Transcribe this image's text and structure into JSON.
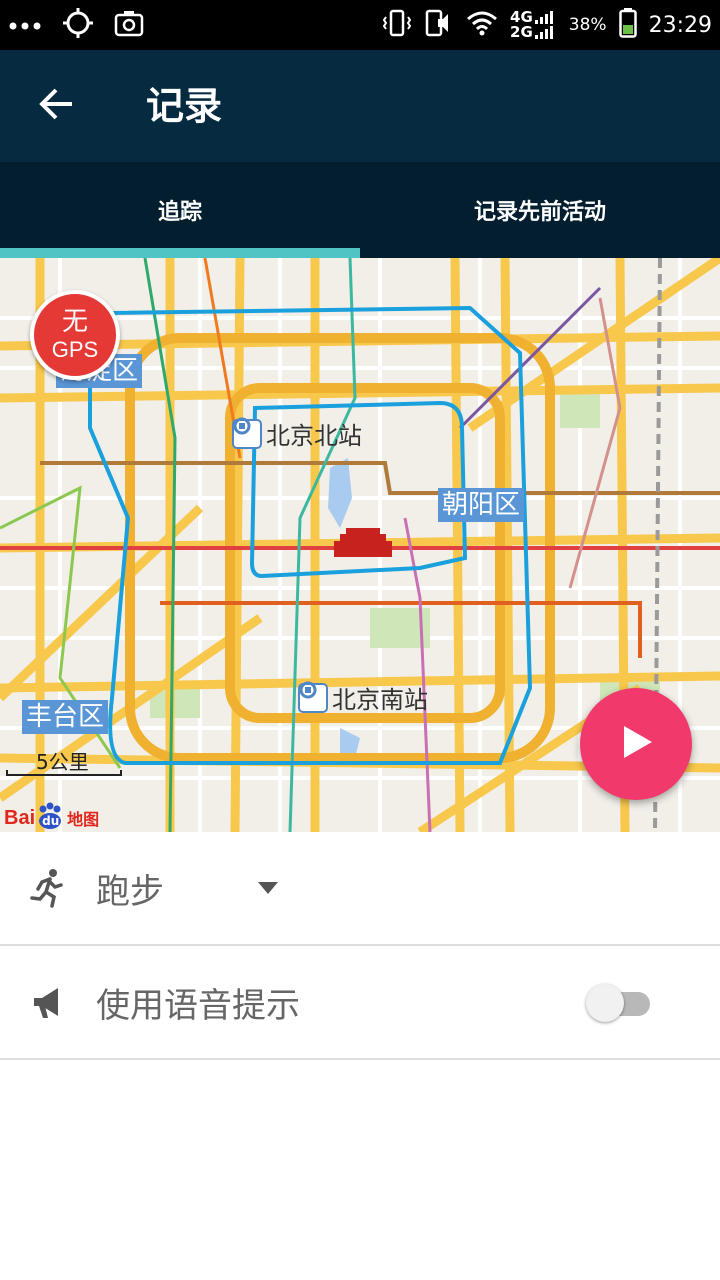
{
  "status_bar": {
    "battery_percent": "38%",
    "time": "23:29",
    "network_top": "4G",
    "network_bottom": "2G",
    "icons": [
      "more-dots-icon",
      "location-target-icon",
      "screenshot-icon",
      "vibrate-icon",
      "silent-speaker-icon",
      "wifi-icon",
      "signal-icon",
      "battery-icon"
    ]
  },
  "app_bar": {
    "title": "记录",
    "back_icon": "arrow-left-icon"
  },
  "tabs": [
    {
      "label": "追踪",
      "selected": true
    },
    {
      "label": "记录先前活动",
      "selected": false
    }
  ],
  "map": {
    "districts": {
      "haidian": "海淀区",
      "chaoyang": "朝阳区",
      "fengtai": "丰台区"
    },
    "stations": {
      "north": "北京北站",
      "south": "北京南站"
    },
    "scale": "5公里",
    "provider": {
      "bai": "Bai",
      "du": "du",
      "map": "地图"
    },
    "gps_badge": {
      "line1": "无",
      "line2": "GPS"
    },
    "play_icon": "play-icon"
  },
  "settings": {
    "activity": {
      "icon": "running-person-icon",
      "label": "跑步"
    },
    "voice": {
      "icon": "megaphone-icon",
      "label": "使用语音提示",
      "enabled": false
    }
  },
  "colors": {
    "app_bar": "#062a40",
    "tab_bar": "#021e2f",
    "tab_indicator": "#4fc4c4",
    "fab": "#f2396c",
    "gps_badge": "#e53935"
  }
}
